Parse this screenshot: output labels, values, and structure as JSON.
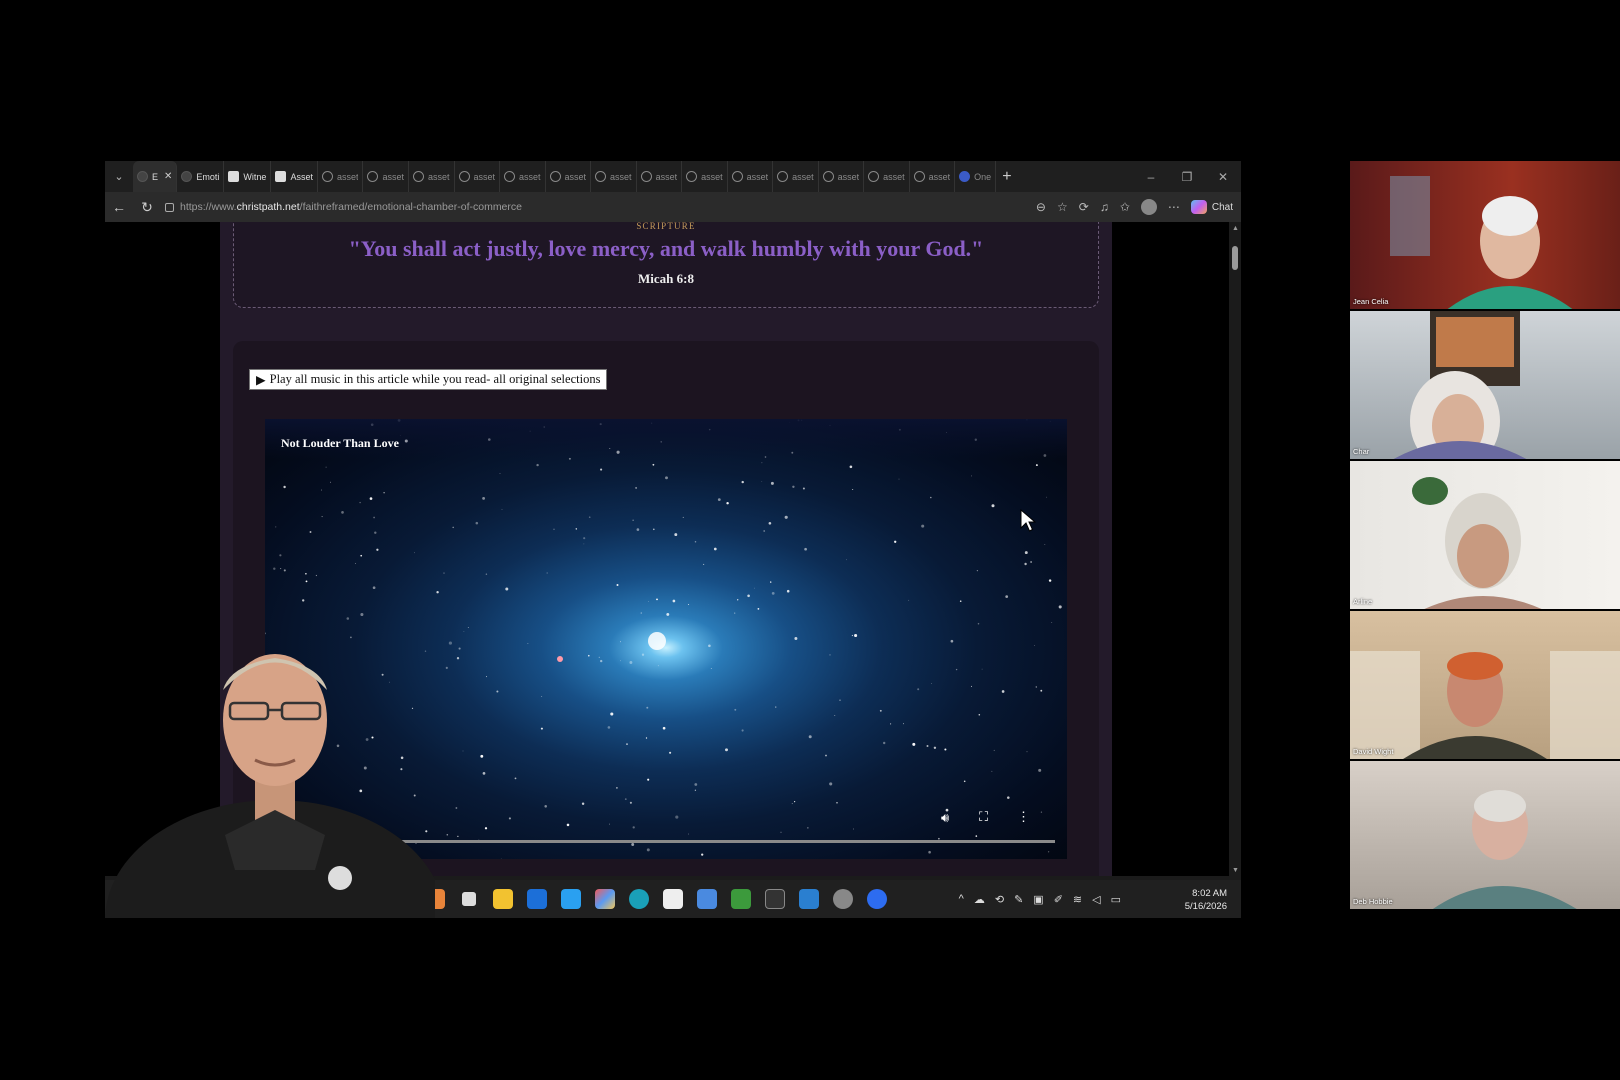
{
  "browser": {
    "tabs": [
      {
        "label": "E",
        "favicon": "edge-dark",
        "active": true
      },
      {
        "label": "Emoti",
        "favicon": "dark-circle"
      },
      {
        "label": "Witne",
        "favicon": "doc"
      },
      {
        "label": "Asset",
        "favicon": "doc"
      },
      {
        "label": "asset",
        "favicon": "globe"
      },
      {
        "label": "asset",
        "favicon": "globe"
      },
      {
        "label": "asset",
        "favicon": "globe"
      },
      {
        "label": "asset",
        "favicon": "globe"
      },
      {
        "label": "asset",
        "favicon": "globe"
      },
      {
        "label": "asset",
        "favicon": "globe"
      },
      {
        "label": "asset",
        "favicon": "globe"
      },
      {
        "label": "asset",
        "favicon": "globe"
      },
      {
        "label": "asset",
        "favicon": "globe"
      },
      {
        "label": "asset",
        "favicon": "globe"
      },
      {
        "label": "asset",
        "favicon": "globe"
      },
      {
        "label": "asset",
        "favicon": "globe"
      },
      {
        "label": "asset",
        "favicon": "globe"
      },
      {
        "label": "asset",
        "favicon": "globe"
      },
      {
        "label": "One",
        "favicon": "blue"
      }
    ],
    "url_prefix": "https://www.",
    "url_host": "christpath.net",
    "url_path": "/faithreframed/emotional-chamber-of-commerce",
    "chat_label": "Chat"
  },
  "article": {
    "scripture_label": "SCRIPTURE",
    "scripture_quote": "\"You shall act justly, love mercy, and walk humbly with your God.\"",
    "scripture_ref": "Micah 6:8",
    "play_all_button": "Play all music in this article while you read- all original selections",
    "play_icon": "▶",
    "video_title": "Not Louder Than Love"
  },
  "taskbar": {
    "time": "8:02 AM",
    "date": "5/16/2026"
  },
  "participants": [
    {
      "name": "Jean Celia"
    },
    {
      "name": "Char"
    },
    {
      "name": "Arline"
    },
    {
      "name": "David Wight"
    },
    {
      "name": "Deb Hobbie"
    }
  ],
  "colors": {
    "scripture_quote": "#8b5fc7",
    "scripture_label": "#c49a5a",
    "article_bg": "#231a2a"
  }
}
